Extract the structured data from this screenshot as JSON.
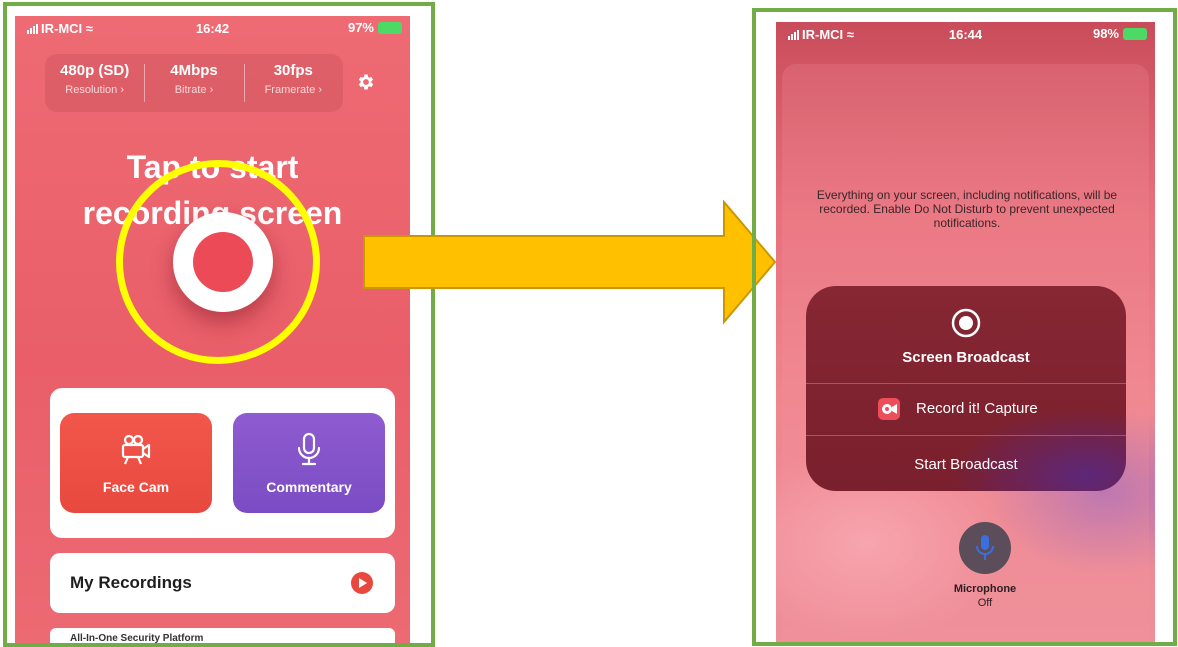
{
  "left_phone": {
    "status": {
      "carrier": "IR-MCI",
      "time": "16:42",
      "battery": "97%"
    },
    "settings": [
      {
        "value": "480p (SD)",
        "label": "Resolution"
      },
      {
        "value": "4Mbps",
        "label": "Bitrate"
      },
      {
        "value": "30fps",
        "label": "Framerate"
      }
    ],
    "headline": {
      "line1": "Tap to start",
      "line2": "recording screen"
    },
    "modes": {
      "facecam": "Face Cam",
      "commentary": "Commentary"
    },
    "recordings_title": "My Recordings",
    "ad_text": "All-In-One Security Platform"
  },
  "right_phone": {
    "status": {
      "carrier": "IR-MCI",
      "time": "16:44",
      "battery": "98%"
    },
    "notice": "Everything on your screen, including notifications, will be recorded. Enable Do Not Disturb to prevent unexpected notifications.",
    "broadcast_title": "Screen Broadcast",
    "app_name": "Record it! Capture",
    "start_label": "Start Broadcast",
    "microphone": {
      "label": "Microphone",
      "state": "Off"
    }
  },
  "colors": {
    "frame_border": "#70ad47",
    "highlight": "#ffff00",
    "arrow": "#ffc000",
    "arrow_border": "#c99700",
    "accent_red": "#eb4a56",
    "commentary_purple": "#8055c8"
  }
}
